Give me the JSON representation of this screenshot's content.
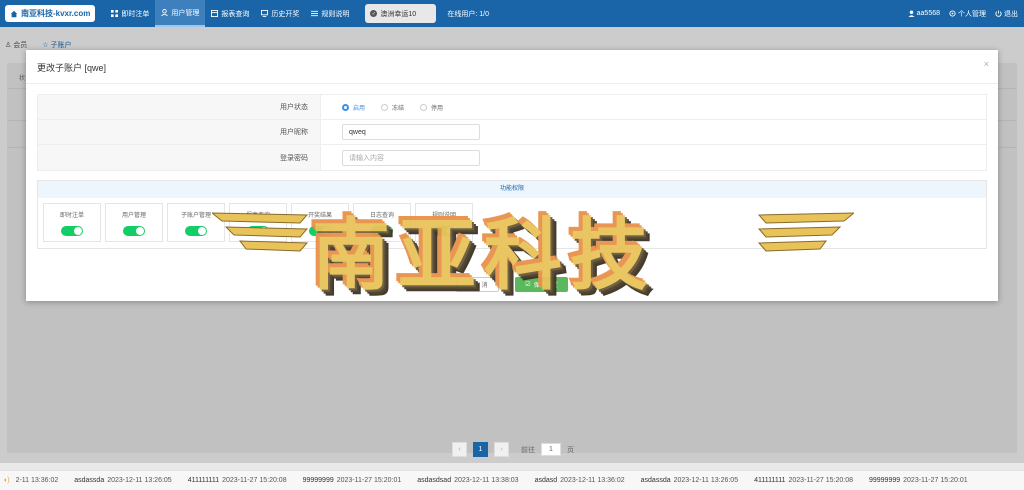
{
  "brand": {
    "logo_text": "南亚科技-kvxr.com"
  },
  "nav": {
    "items": [
      {
        "label": "即时注单",
        "active": false
      },
      {
        "label": "用户管理",
        "active": true
      },
      {
        "label": "报表查询",
        "active": false
      },
      {
        "label": "历史开奖",
        "active": false
      },
      {
        "label": "规则说明",
        "active": false
      }
    ],
    "lottery_select": "澳洲幸运10",
    "online_users": "在线用户: 1/0",
    "user": "aa5568",
    "profile": "个人管理",
    "logout": "退出"
  },
  "subtabs": {
    "tab1": "会员",
    "tab2": "子账户"
  },
  "background": {
    "col_label": "状"
  },
  "modal": {
    "title": "更改子账户 [qwe]",
    "close": "×",
    "fields": {
      "status_label": "用户状态",
      "status_options": [
        "启用",
        "冻结",
        "停用"
      ],
      "status_selected": "启用",
      "nickname_label": "用户昵称",
      "nickname_value": "qweq",
      "password_label": "登录密码",
      "password_placeholder": "请输入内容"
    },
    "permissions": {
      "heading": "功能权限",
      "items": [
        {
          "label": "即时注单",
          "enabled": true
        },
        {
          "label": "用户管理",
          "enabled": true
        },
        {
          "label": "子账户管理",
          "enabled": true
        },
        {
          "label": "报表查询",
          "enabled": true
        },
        {
          "label": "开奖结果",
          "enabled": true
        },
        {
          "label": "日志查询",
          "enabled": true
        },
        {
          "label": "规则说明",
          "enabled": true
        }
      ]
    },
    "cancel_label": "取 消",
    "save_label": "保存设置"
  },
  "watermark": {
    "text": "南亚科技"
  },
  "pagination": {
    "current": "1",
    "goto_label": "前往",
    "goto_value": "1",
    "page_suffix": "页"
  },
  "ticker": [
    {
      "user": "",
      "time": "2-11 13:36:02"
    },
    {
      "user": "asdassda",
      "time": "2023-12-11 13:26:05"
    },
    {
      "user": "411111111",
      "time": "2023-11-27 15:20:08"
    },
    {
      "user": "99999999",
      "time": "2023-11-27 15:20:01"
    },
    {
      "user": "asdasdsad",
      "time": "2023-12-11 13:38:03"
    },
    {
      "user": "asdasd",
      "time": "2023-12-11 13:36:02"
    },
    {
      "user": "asdassda",
      "time": "2023-12-11 13:26:05"
    },
    {
      "user": "411111111",
      "time": "2023-11-27 15:20:08"
    },
    {
      "user": "99999999",
      "time": "2023-11-27 15:20:01"
    }
  ],
  "colors": {
    "primary": "#1a65a8",
    "success": "#13ce66",
    "save": "#5cb85c"
  }
}
